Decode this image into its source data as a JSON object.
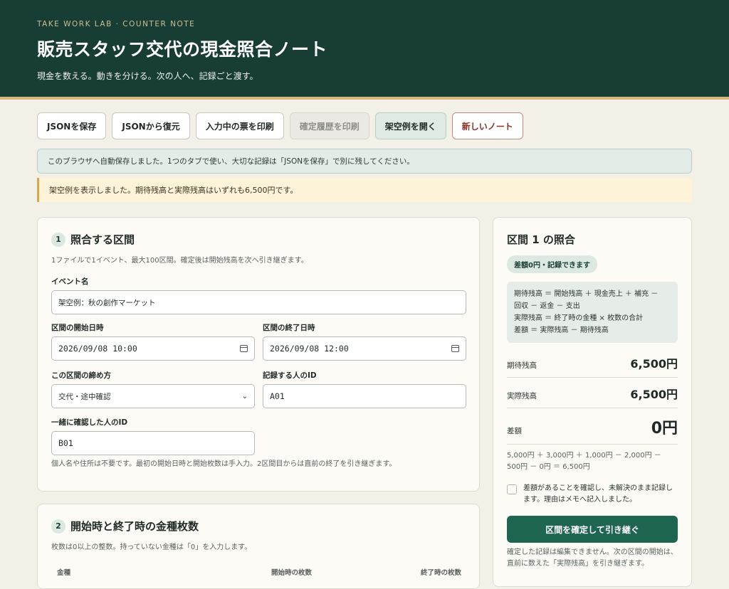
{
  "header": {
    "eyebrow": "TAKE WORK LAB · COUNTER NOTE",
    "title": "販売スタッフ交代の現金照合ノート",
    "subtitle": "現金を数える。動きを分ける。次の人へ、記録ごと渡す。"
  },
  "toolbar": {
    "save_json": "JSONを保存",
    "restore_json": "JSONから復元",
    "print_current": "入力中の票を印刷",
    "print_history": "確定履歴を印刷",
    "open_example": "架空例を開く",
    "new_note": "新しいノート"
  },
  "notice": "このブラウザへ自動保存しました。1つのタブで使い、大切な記録は「JSONを保存」で別に残してください。",
  "alert": "架空例を表示しました。期待残高と実際残高はいずれも6,500円です。",
  "section1": {
    "number": "1",
    "title": "照合する区間",
    "hint": "1ファイルで1イベント、最大100区間。確定後は開始残高を次へ引き継ぎます。",
    "event_label": "イベント名",
    "event_value": "架空例：秋の創作マーケット",
    "start_label": "区間の開始日時",
    "start_value": "2026/09/08 10:00",
    "end_label": "区間の終了日時",
    "end_value": "2026/09/08 12:00",
    "close_label": "この区間の締め方",
    "close_value": "交代・途中確認",
    "recorder_label": "記録する人のID",
    "recorder_value": "A01",
    "witness_label": "一緒に確認した人のID",
    "witness_value": "B01",
    "footnote": "個人名や住所は不要です。最初の開始日時と開始枚数は手入力。2区間目からは直前の終了を引き継ぎます。"
  },
  "section2": {
    "number": "2",
    "title": "開始時と終了時の金種枚数",
    "hint": "枚数は0以上の整数。持っていない金種は「0」を入力します。",
    "columns": [
      "金種",
      "開始時の枚数",
      "終了時の枚数"
    ]
  },
  "summary": {
    "title": "区間 1 の照合",
    "badge": "差額0円・記録できます",
    "formula": [
      "期待残高 ＝ 開始残高 ＋ 現金売上 ＋ 補充 －",
      "回収 － 返金 － 支出",
      "実際残高 ＝ 終了時の金種 × 枚数の合計",
      "差額 ＝ 実際残高 － 期待残高"
    ],
    "expected_label": "期待残高",
    "expected_value": "6,500円",
    "actual_label": "実際残高",
    "actual_value": "6,500円",
    "diff_label": "差額",
    "diff_value": "0円",
    "calc": [
      "5,000円 ＋ 3,000円 ＋ 1,000円 － 2,000円 －",
      "500円 － 0円 ＝ 6,500円"
    ],
    "confirm_text": "差額があることを確認し、未解決のまま記録します。理由はメモへ記入しました。",
    "confirm_checked": false,
    "primary_button": "区間を確定して引き継ぐ",
    "after_note": "確定した記録は編集できません。次の区間の開始は、直前に数えた「実際残高」を引き継ぎます。"
  }
}
